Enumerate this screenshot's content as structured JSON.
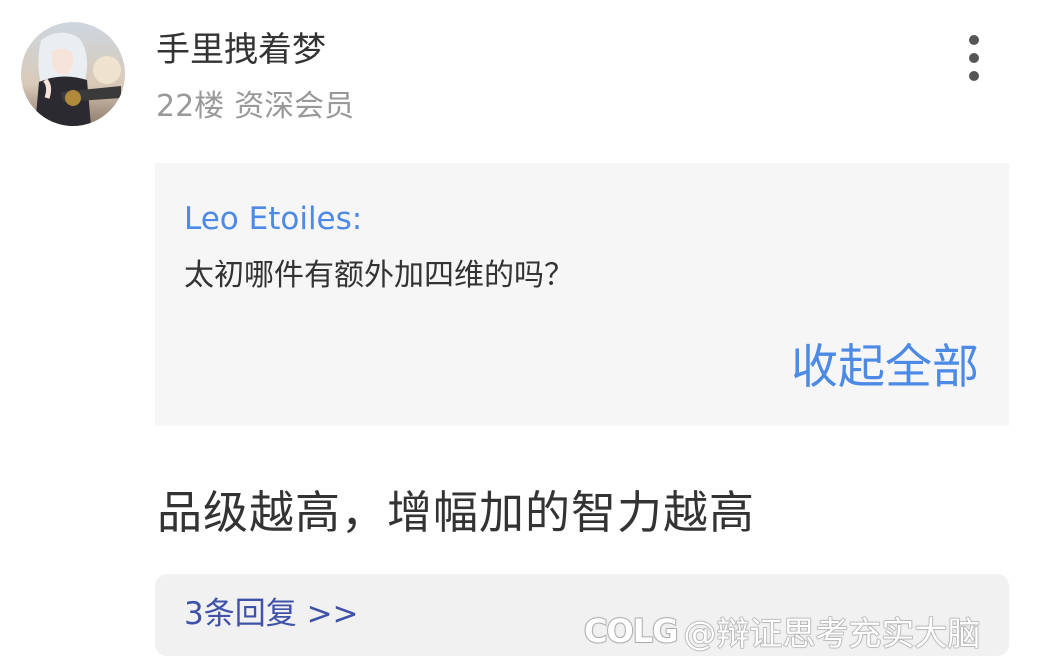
{
  "post": {
    "username": "手里拽着梦",
    "floor": "22楼",
    "member_level": "资深会员",
    "more_icon": "more-vertical-icon",
    "avatar_icon": "avatar-image"
  },
  "quote": {
    "author": "Leo Etoiles:",
    "text": "太初哪件有额外加四维的吗？",
    "collapse_label": "收起全部"
  },
  "content": {
    "text": "品级越高，增幅加的智力越高"
  },
  "replies": {
    "label": "3条回复 >>"
  },
  "watermark": {
    "logo": "COLG",
    "text": "@辩证思考充实大脑"
  },
  "colors": {
    "link_blue": "#4c8ae6",
    "replies_blue": "#3f52a8",
    "quote_bg": "#f6f6f6",
    "replies_bg": "#f1f1f1",
    "text_primary": "#333333",
    "text_secondary": "#999999"
  }
}
